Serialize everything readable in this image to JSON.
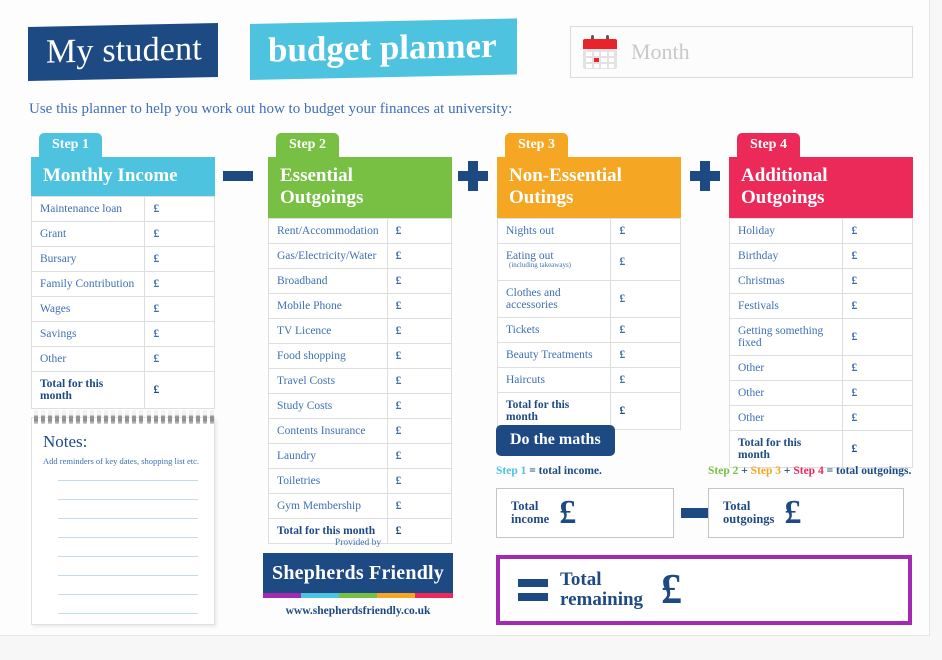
{
  "header": {
    "title_part1": "My student",
    "title_part2": "budget planner",
    "month_placeholder": "Month",
    "calendar_icon": "calendar-icon",
    "subtitle": "Use this planner to help you work out how to budget your finances at university:"
  },
  "colors": {
    "navy": "#1e4a84",
    "cyan": "#4ec3e0",
    "green": "#77c043",
    "orange": "#f5a623",
    "pink": "#ec2a5a",
    "purple": "#a32bb0"
  },
  "currency": "£",
  "total_row_label": "Total for this month",
  "steps": [
    {
      "tab": "Step 1",
      "heading": "Monthly Income",
      "color": "#4ec3e0",
      "rows": [
        "Maintenance loan",
        "Grant",
        "Bursary",
        "Family Contribution",
        "Wages",
        "Savings",
        "Other"
      ]
    },
    {
      "tab": "Step 2",
      "heading": "Essential Outgoings",
      "color": "#77c043",
      "rows": [
        "Rent/Accommodation",
        "Gas/Electricity/Water",
        "Broadband",
        "Mobile Phone",
        "TV Licence",
        "Food shopping",
        "Travel Costs",
        "Study Costs",
        "Contents Insurance",
        "Laundry",
        "Toiletries",
        "Gym Membership"
      ]
    },
    {
      "tab": "Step 3",
      "heading": "Non-Essential Outings",
      "color": "#f5a623",
      "rows": [
        "Nights out",
        "Eating out",
        "Clothes and accessories",
        "Tickets",
        "Beauty Treatments",
        "Haircuts"
      ],
      "row_notes": {
        "1": "(including takeaways)"
      }
    },
    {
      "tab": "Step 4",
      "heading": "Additional Outgoings",
      "color": "#ec2a5a",
      "rows": [
        "Holiday",
        "Birthday",
        "Christmas",
        "Festivals",
        "Getting something fixed",
        "Other",
        "Other",
        "Other"
      ]
    }
  ],
  "operators": {
    "minus": "minus-icon",
    "plus_1": "plus-icon",
    "plus_2": "plus-icon"
  },
  "notes": {
    "title": "Notes:",
    "hint": "Add reminders of key dates, shopping list etc.",
    "line_count": 8
  },
  "provided": {
    "label": "Provided by",
    "brand": "Shepherds Friendly",
    "url": "www.shepherdsfriendly.co.uk",
    "stripe": [
      "#a32bb0",
      "#4ec3e0",
      "#77c043",
      "#f5a623",
      "#ec2a5a"
    ]
  },
  "maths": {
    "tab": "Do the maths",
    "income_formula_step": "Step 1",
    "income_formula_rest": " = total income.",
    "outgoings_step2": "Step 2",
    "outgoings_plus1": " + ",
    "outgoings_step3": "Step 3",
    "outgoings_plus2": " + ",
    "outgoings_step4": "Step 4",
    "outgoings_rest": " = total outgoings.",
    "total_income_line1": "Total",
    "total_income_line2": "income",
    "total_outgoings_line1": "Total",
    "total_outgoings_line2": "outgoings",
    "minus_icon": "minus-icon",
    "equals_icon": "equals-icon",
    "remaining_line1": "Total",
    "remaining_line2": "remaining"
  }
}
